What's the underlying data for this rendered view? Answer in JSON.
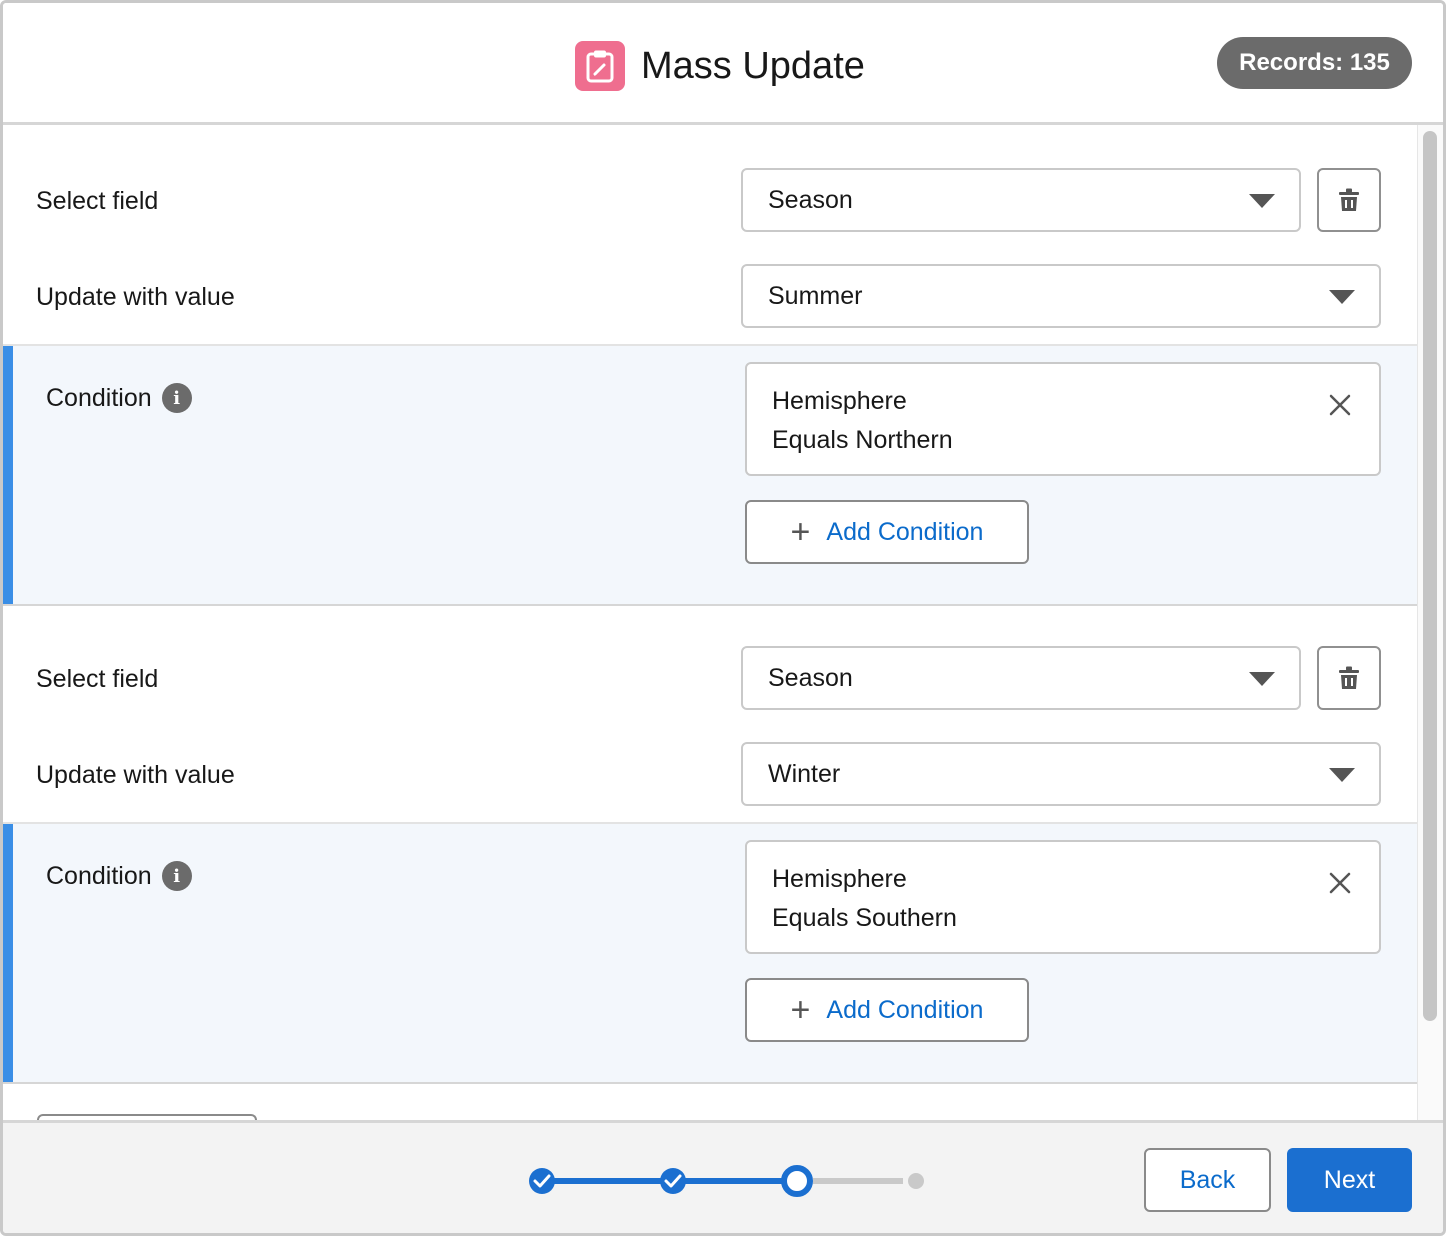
{
  "header": {
    "title": "Mass Update",
    "records_badge": "Records: 135",
    "app_icon": "clipboard-edit-icon"
  },
  "updates": [
    {
      "select_field_label": "Select field",
      "field_value": "Season",
      "update_value_label": "Update with value",
      "update_value": "Summer",
      "condition_label": "Condition",
      "condition": {
        "field": "Hemisphere",
        "operator_value": "Equals Northern"
      },
      "add_condition_label": "Add Condition"
    },
    {
      "select_field_label": "Select field",
      "field_value": "Season",
      "update_value_label": "Update with value",
      "update_value": "Winter",
      "condition_label": "Condition",
      "condition": {
        "field": "Hemisphere",
        "operator_value": "Equals Southern"
      },
      "add_condition_label": "Add Condition"
    }
  ],
  "footer": {
    "back_label": "Back",
    "next_label": "Next",
    "progress": {
      "total_steps": 4,
      "completed_steps": 2,
      "current_step": 3
    }
  },
  "colors": {
    "accent_blue": "#1b6fd0",
    "link_blue": "#0b6bcb",
    "condition_bar": "#3a8ee6",
    "app_icon_pink": "#ef6e8f",
    "badge_gray": "#6b6b6b"
  }
}
